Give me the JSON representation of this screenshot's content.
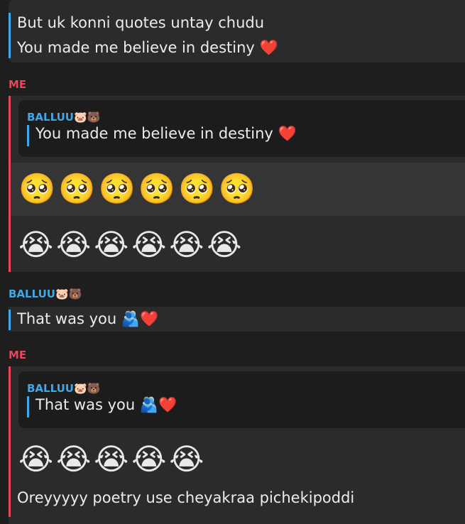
{
  "messages": [
    {
      "lines": [
        "But uk konni quotes untay chudu",
        "You made me believe in destiny ❤️"
      ]
    },
    {
      "sender": "ME",
      "reply_to": {
        "name": "BALLUU🐷🐻",
        "text": "You made me believe in destiny ❤️"
      },
      "emoji_row_1": "🥺🥺🥺🥺🥺🥺",
      "emoji_row_2": "😭😭😭😭😭😭"
    },
    {
      "sender": "BALLUU🐷🐻",
      "text": "That was you 🫂❤️"
    },
    {
      "sender": "ME",
      "reply_to": {
        "name": "BALLUU🐷🐻",
        "text": "That was you 🫂❤️"
      },
      "emoji_row": "😭😭😭😭😭",
      "text": "Oreyyyyy poetry use cheyakraa pichekipoddi"
    }
  ],
  "colors": {
    "background": "#1e1e1e",
    "bubble": "#2b2b2b",
    "bubble_alt": "#353535",
    "quote_bg": "#1c1c1c",
    "me_accent": "#e9455c",
    "balluu_accent": "#3ea8e8"
  }
}
